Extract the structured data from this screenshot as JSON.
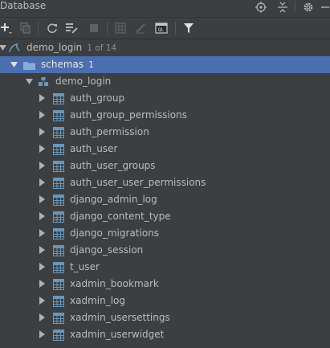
{
  "window": {
    "title": "Database"
  },
  "toolbar": {
    "buttons": [
      "add-icon",
      "duplicate-icon",
      "refresh-icon",
      "ddl-icon",
      "stop-icon",
      "table-view-icon",
      "edit-icon",
      "console-icon",
      "filter-icon"
    ]
  },
  "tree": {
    "root": {
      "label": "demo_login",
      "count": "1 of 14"
    },
    "schemas": {
      "label": "schemas",
      "count": "1"
    },
    "schema": {
      "label": "demo_login"
    },
    "tables": [
      "auth_group",
      "auth_group_permissions",
      "auth_permission",
      "auth_user",
      "auth_user_groups",
      "auth_user_user_permissions",
      "django_admin_log",
      "django_content_type",
      "django_migrations",
      "django_session",
      "t_user",
      "xadmin_bookmark",
      "xadmin_log",
      "xadmin_usersettings",
      "xadmin_userwidget"
    ]
  },
  "colors": {
    "background": "#3c3f41",
    "selection": "#4b6eaf",
    "table_icon": "#6897bb",
    "text": "#bbbbbb"
  }
}
